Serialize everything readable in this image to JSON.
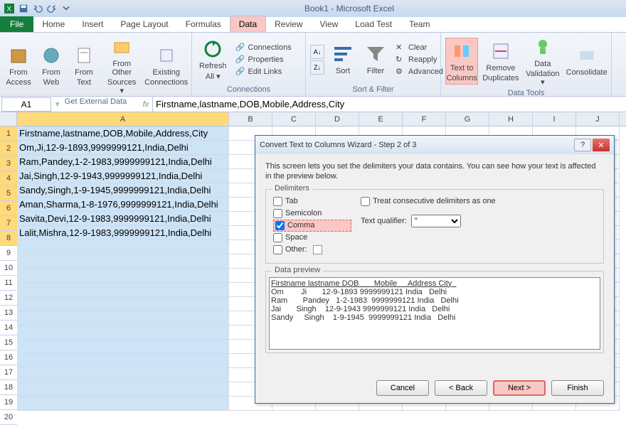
{
  "title": "Book1 - Microsoft Excel",
  "qat": {
    "excel": "X",
    "save": "save",
    "undo": "undo",
    "redo": "redo"
  },
  "tabs": [
    "File",
    "Home",
    "Insert",
    "Page Layout",
    "Formulas",
    "Data",
    "Review",
    "View",
    "Load Test",
    "Team"
  ],
  "active_tab": "Data",
  "ribbon": {
    "ext": {
      "label": "Get External Data",
      "buttons": [
        {
          "l1": "From",
          "l2": "Access"
        },
        {
          "l1": "From",
          "l2": "Web"
        },
        {
          "l1": "From",
          "l2": "Text"
        },
        {
          "l1": "From Other",
          "l2": "Sources ▾"
        },
        {
          "l1": "Existing",
          "l2": "Connections"
        }
      ]
    },
    "conn": {
      "label": "Connections",
      "refresh": {
        "l1": "Refresh",
        "l2": "All ▾"
      },
      "items": [
        "Connections",
        "Properties",
        "Edit Links"
      ]
    },
    "sort": {
      "label": "Sort & Filter",
      "sort": "Sort",
      "filter": "Filter",
      "items": [
        "Clear",
        "Reapply",
        "Advanced"
      ]
    },
    "tools": {
      "label": "Data Tools",
      "buttons": [
        {
          "l1": "Text to",
          "l2": "Columns",
          "hl": true
        },
        {
          "l1": "Remove",
          "l2": "Duplicates"
        },
        {
          "l1": "Data",
          "l2": "Validation ▾"
        },
        {
          "l1": "Consolidate",
          "l2": ""
        }
      ]
    }
  },
  "name_box": "A1",
  "formula": "Firstname,lastname,DOB,Mobile,Address,City",
  "columns": [
    "A",
    "B",
    "C",
    "D",
    "E",
    "F",
    "G",
    "H",
    "I",
    "J"
  ],
  "rows_data": [
    "Firstname,lastname,DOB,Mobile,Address,City",
    "Om,Ji,12-9-1893,9999999121,India,Delhi",
    "Ram,Pandey,1-2-1983,9999999121,India,Delhi",
    "Jai,Singh,12-9-1943,9999999121,India,Delhi",
    "Sandy,Singh,1-9-1945,9999999121,India,Delhi",
    "Aman,Sharma,1-8-1976,9999999121,India,Delhi",
    "Savita,Devi,12-9-1983,9999999121,India,Delhi",
    "Lalit,Mishra,12-9-1983,9999999121,India,Delhi"
  ],
  "total_rows": 20,
  "dialog": {
    "title": "Convert Text to Columns Wizard - Step 2 of 3",
    "instr": "This screen lets you set the delimiters your data contains.  You can see how your text is affected in the preview below.",
    "delim_legend": "Delimiters",
    "tab": "Tab",
    "semi": "Semicolon",
    "comma": "Comma",
    "space": "Space",
    "other": "Other:",
    "treat": "Treat consecutive delimiters as one",
    "qual_label": "Text qualifier:",
    "qual_val": "\"",
    "preview_legend": "Data preview",
    "prev_cols": [
      "Firstname",
      "lastname",
      "DOB",
      "Mobile",
      "Address",
      "City"
    ],
    "prev_rows": [
      [
        "Om",
        "Ji",
        "12-9-1893",
        "9999999121",
        "India",
        "Delhi"
      ],
      [
        "Ram",
        "Pandey",
        "1-2-1983",
        "9999999121",
        "India",
        "Delhi"
      ],
      [
        "Jai",
        "Singh",
        "12-9-1943",
        "9999999121",
        "India",
        "Delhi"
      ],
      [
        "Sandy",
        "Singh",
        "1-9-1945",
        "9999999121",
        "India",
        "Delhi"
      ]
    ],
    "btn_cancel": "Cancel",
    "btn_back": "< Back",
    "btn_next": "Next >",
    "btn_finish": "Finish"
  }
}
